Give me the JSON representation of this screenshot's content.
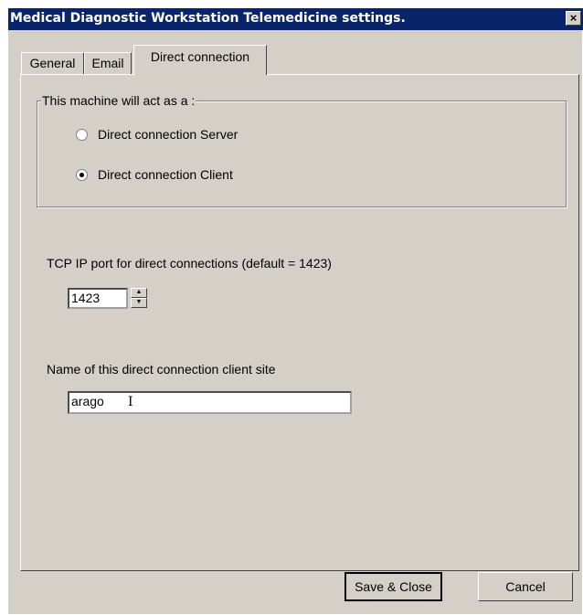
{
  "window": {
    "title": "Medical Diagnostic Workstation Telemedicine settings.",
    "close_symbol": "×"
  },
  "tabs": [
    {
      "label": "General",
      "active": false
    },
    {
      "label": "Email",
      "active": false
    },
    {
      "label": "Direct connection",
      "active": true
    }
  ],
  "group": {
    "legend": "This machine will act as a :",
    "options": [
      {
        "label": "Direct connection Server",
        "selected": false
      },
      {
        "label": "Direct connection Client",
        "selected": true
      }
    ]
  },
  "port": {
    "label": "TCP IP port for direct connections (default = 1423)",
    "value": "1423",
    "spin_up_icon": "▲",
    "spin_down_icon": "▼"
  },
  "site": {
    "label": "Name of this direct connection client site",
    "value": "arago",
    "cursor_icon": "I"
  },
  "buttons": {
    "save_label": "Save & Close",
    "cancel_label": "Cancel"
  }
}
